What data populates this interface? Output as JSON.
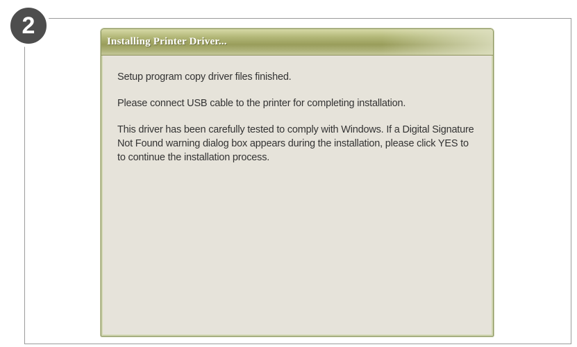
{
  "step": {
    "number": "2"
  },
  "dialog": {
    "title": "Installing Printer Driver...",
    "messages": {
      "copy_finished": "Setup program copy driver files finished.",
      "connect_usb": "Please connect USB cable to the printer for completing installation.",
      "signature_notice": "This driver has been carefully tested to comply with Windows. If a Digital Signature Not Found warning dialog box appears during the installation, please click YES to to continue the installation process."
    }
  },
  "colors": {
    "badge": "#4d4d4d",
    "dialog_background": "#e6e3da",
    "titlebar": "#999d5b",
    "text": "#333333"
  }
}
